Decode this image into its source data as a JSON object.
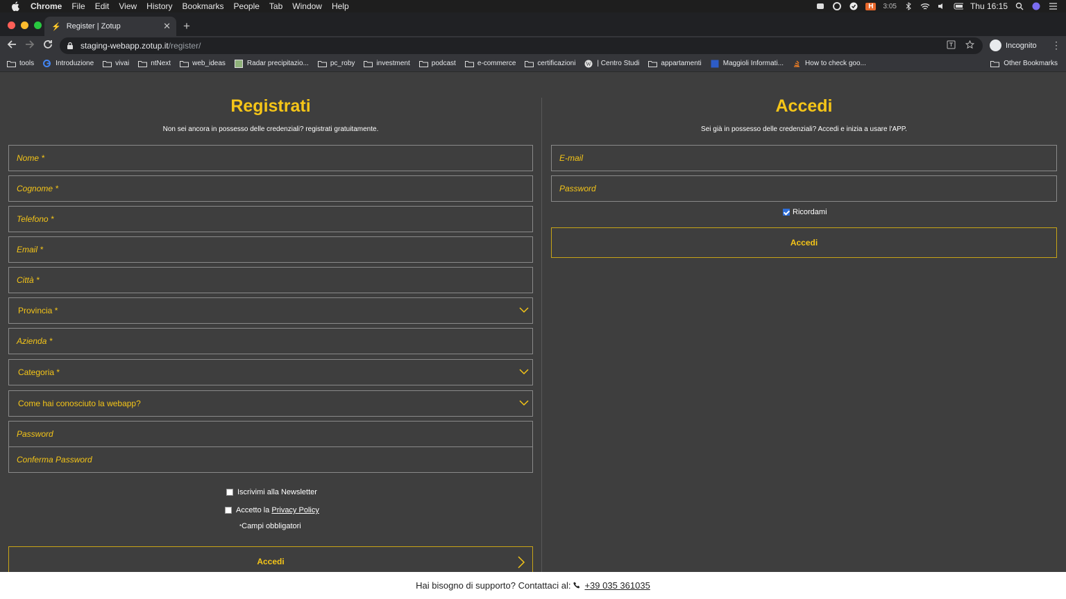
{
  "menubar": {
    "items": [
      "Chrome",
      "File",
      "Edit",
      "View",
      "History",
      "Bookmarks",
      "People",
      "Tab",
      "Window",
      "Help"
    ],
    "status_badge": "H",
    "status_time_small": "3:05",
    "clock": "Thu 16:15"
  },
  "browser": {
    "tab_title": "Register | Zotup",
    "url_host": "staging-webapp.zotup.it",
    "url_path": "/register/",
    "profile_label": "Incognito",
    "bookmarks": [
      {
        "label": "tools",
        "icon": "folder-icon"
      },
      {
        "label": "Introduzione",
        "icon": "google-icon"
      },
      {
        "label": "vivai",
        "icon": "folder-icon"
      },
      {
        "label": "ntNext",
        "icon": "folder-icon"
      },
      {
        "label": "web_ideas",
        "icon": "folder-icon"
      },
      {
        "label": "Radar precipitazio...",
        "icon": "map-icon"
      },
      {
        "label": "pc_roby",
        "icon": "folder-icon"
      },
      {
        "label": "investment",
        "icon": "folder-icon"
      },
      {
        "label": "podcast",
        "icon": "folder-icon"
      },
      {
        "label": "e-commerce",
        "icon": "folder-icon"
      },
      {
        "label": "certificazioni",
        "icon": "folder-icon"
      },
      {
        "label": "| Centro Studi",
        "icon": "wordpress-icon"
      },
      {
        "label": "appartamenti",
        "icon": "folder-icon"
      },
      {
        "label": "Maggioli Informati...",
        "icon": "site-icon"
      },
      {
        "label": "How to check goo...",
        "icon": "stack-icon"
      }
    ],
    "other_bookmarks": "Other Bookmarks"
  },
  "register": {
    "title": "Registrati",
    "subtitle": "Non sei ancora in possesso delle credenziali? registrati gratuitamente.",
    "fields": {
      "nome": "Nome *",
      "cognome": "Cognome *",
      "telefono": "Telefono *",
      "email": "Email *",
      "citta": "Città *",
      "provincia": "Provincia *",
      "azienda": "Azienda *",
      "categoria": "Categoria *",
      "come": "Come hai conosciuto la webapp?",
      "password": "Password",
      "conferma": "Conferma Password"
    },
    "newsletter_label": "Iscrivimi alla Newsletter",
    "privacy_prefix": "Accetto la",
    "privacy_link": "Privacy Policy",
    "required_note": "Campi obbligatori",
    "required_mark": "*",
    "submit": "Accedi"
  },
  "login": {
    "title": "Accedi",
    "subtitle": "Sei già in possesso delle credenziali? Accedi e inizia a usare l'APP.",
    "email_placeholder": "E-mail",
    "password_placeholder": "Password",
    "remember_label": "Ricordami",
    "remember_checked": true,
    "submit": "Accedi"
  },
  "footer": {
    "text": "Hai bisogno di supporto? Contattaci al:",
    "phone": "+39 035 361035"
  },
  "colors": {
    "accent": "#f5c518",
    "page_bg": "#3e3e3e",
    "border": "#8a8a8a"
  }
}
